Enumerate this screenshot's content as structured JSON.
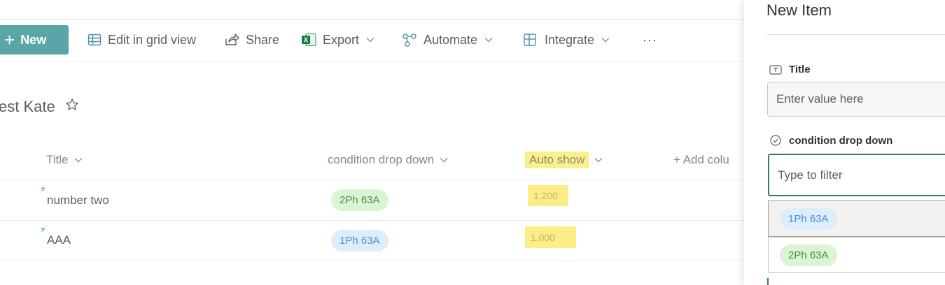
{
  "toolbar": {
    "new_label": "New",
    "edit_grid_label": "Edit in grid view",
    "share_label": "Share",
    "export_label": "Export",
    "automate_label": "Automate",
    "integrate_label": "Integrate",
    "more_label": "···"
  },
  "list": {
    "title": "est Kate",
    "columns": {
      "title": "Title",
      "condition": "condition drop down",
      "auto_show": "Auto show",
      "add_column": "+ Add colu"
    },
    "rows": [
      {
        "title": "number two",
        "condition": "2Ph 63A",
        "condition_color": "green",
        "auto_show": "1,200"
      },
      {
        "title": "AAA",
        "condition": "1Ph 63A",
        "condition_color": "blue",
        "auto_show": "1,000"
      }
    ]
  },
  "panel": {
    "title": "New Item",
    "title_field_label": "Title",
    "title_field_placeholder": "Enter value here",
    "condition_label": "condition drop down",
    "filter_placeholder": "Type to filter",
    "options": [
      {
        "label": "1Ph 63A",
        "color": "blue",
        "selected": true
      },
      {
        "label": "2Ph 63A",
        "color": "green",
        "selected": false
      }
    ]
  },
  "colors": {
    "accent": "#5aa5a8",
    "focus": "#2e7d73",
    "highlight": "#fbf08a"
  }
}
